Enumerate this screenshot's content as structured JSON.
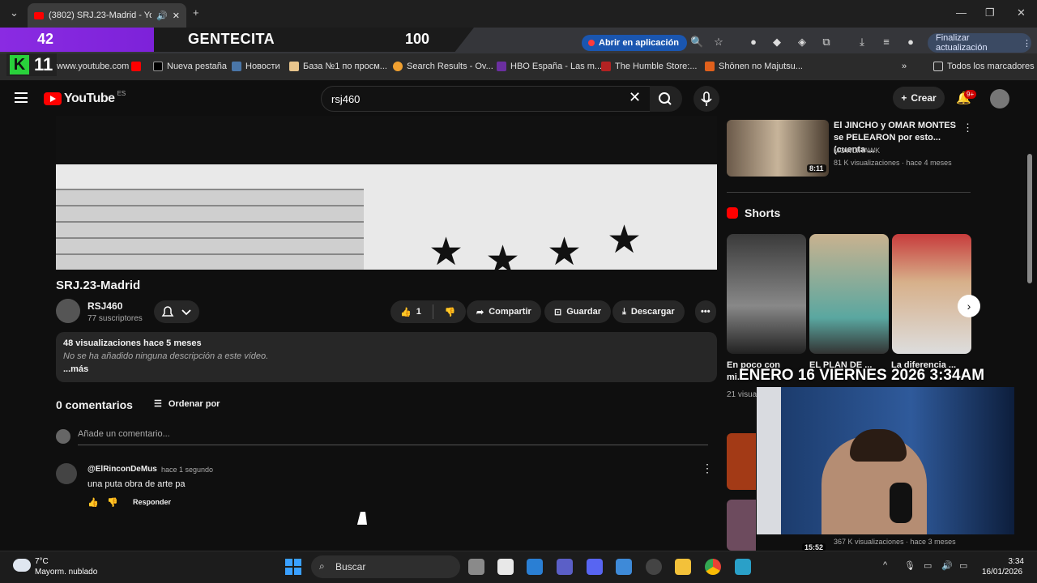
{
  "browser": {
    "tab_title": "(3802) SRJ.23-Madrid - You",
    "open_app": "Abrir en aplicación",
    "update": "Finalizar actualización"
  },
  "overlay": {
    "left_num": "42",
    "title": "GENTECITA",
    "right_num": "100",
    "k_letter": "K",
    "k_num": "11"
  },
  "bookmarks": [
    "www.youtube.com",
    "Nueva pestaña",
    "Новости",
    "База №1 по просм...",
    "Search Results - Ov...",
    "HBO España - Las m...",
    "The Humble Store:...",
    "Shōnen no Majutsu...",
    "Todos los marcadores"
  ],
  "header": {
    "logo": "YouTube",
    "region": "ES",
    "search_value": "rsj460",
    "create": "Crear",
    "notif_badge": "9+"
  },
  "video": {
    "title": "SRJ.23-Madrid",
    "channel": "RSJ460",
    "subscribers": "77 suscriptores",
    "likes": "1",
    "share": "Compartir",
    "save": "Guardar",
    "download": "Descargar",
    "stats": "48 visualizaciones  hace 5 meses",
    "no_desc": "No se ha añadido ninguna descripción a este vídeo.",
    "more": "...más"
  },
  "comments": {
    "count": "0 comentarios",
    "sort": "Ordenar por",
    "placeholder": "Añade un comentario...",
    "author": "@ElRinconDeMus",
    "time": "hace 1 segundo",
    "text": "una puta obra de arte pa",
    "reply": "Responder"
  },
  "sidebar": {
    "rel_title": "El JINCHO y OMAR MONTES se PELEARON por esto... (cuenta ...",
    "rel_channel": "MOWLIHAWK",
    "rel_meta": "81 K visualizaciones · hace 4 meses",
    "rel_duration": "8:11",
    "shorts_label": "Shorts",
    "short_titles": [
      "En poco con mi...",
      "EL PLAN DE ...",
      "La diferencia ..."
    ],
    "short_views": "21 visual...",
    "bottom_duration": "15:52",
    "bottom_meta": "367 K visualizaciones · hace 3 meses"
  },
  "stream": {
    "date_overlay": "ENERO 16 VIERNES 2026 3:34AM"
  },
  "taskbar": {
    "temp": "7°C",
    "weather": "Mayorm. nublado",
    "search": "Buscar",
    "time": "3:34",
    "date": "16/01/2026"
  }
}
